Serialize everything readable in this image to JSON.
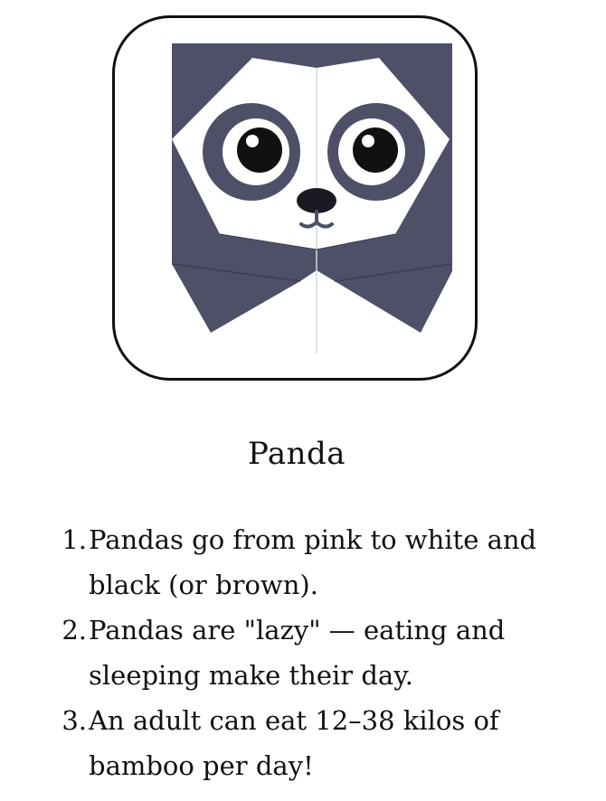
{
  "illustration": {
    "icon": "panda-face-icon",
    "colors": {
      "dark": "#4e5068",
      "white": "#ffffff",
      "outline": "#111111",
      "nose": "#1a1a22",
      "edge": "#cfcfd6"
    }
  },
  "title": "Panda",
  "facts": [
    {
      "number": "1.",
      "text": "Pandas go from pink to white and black (or brown)."
    },
    {
      "number": "2.",
      "text": "Pandas are \"lazy\" — eating and sleeping make their day."
    },
    {
      "number": "3.",
      "text": "An adult can eat 12–38 kilos of bamboo per day!"
    }
  ]
}
